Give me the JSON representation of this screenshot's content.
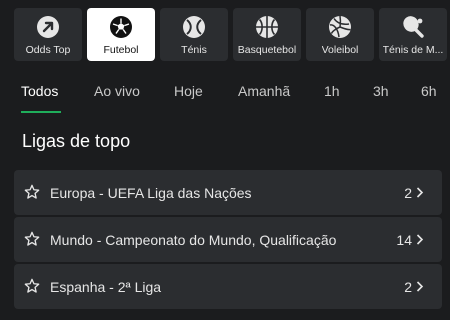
{
  "sports": [
    {
      "label": "Odds Top",
      "icon": "arrow-up-right-icon",
      "active": false
    },
    {
      "label": "Futebol",
      "icon": "soccer-ball-icon",
      "active": true
    },
    {
      "label": "Ténis",
      "icon": "tennis-ball-icon",
      "active": false
    },
    {
      "label": "Basquetebol",
      "icon": "basketball-icon",
      "active": false
    },
    {
      "label": "Voleibol",
      "icon": "volleyball-icon",
      "active": false
    },
    {
      "label": "Ténis de M...",
      "icon": "table-tennis-icon",
      "active": false
    }
  ],
  "tabs": [
    {
      "label": "Todos",
      "active": true
    },
    {
      "label": "Ao vivo",
      "active": false
    },
    {
      "label": "Hoje",
      "active": false
    },
    {
      "label": "Amanhã",
      "active": false
    },
    {
      "label": "1h",
      "active": false
    },
    {
      "label": "3h",
      "active": false
    },
    {
      "label": "6h",
      "active": false
    }
  ],
  "section_title": "Ligas de topo",
  "leagues": [
    {
      "name": "Europa - UEFA Liga das Nações",
      "count": "2"
    },
    {
      "name": "Mundo - Campeonato do Mundo, Qualificação",
      "count": "14"
    },
    {
      "name": "Espanha - 2ª Liga",
      "count": "2"
    }
  ],
  "colors": {
    "background": "#1b1c1e",
    "tile": "#2b2d30",
    "active_tile": "#ffffff",
    "accent": "#1fae5b"
  }
}
